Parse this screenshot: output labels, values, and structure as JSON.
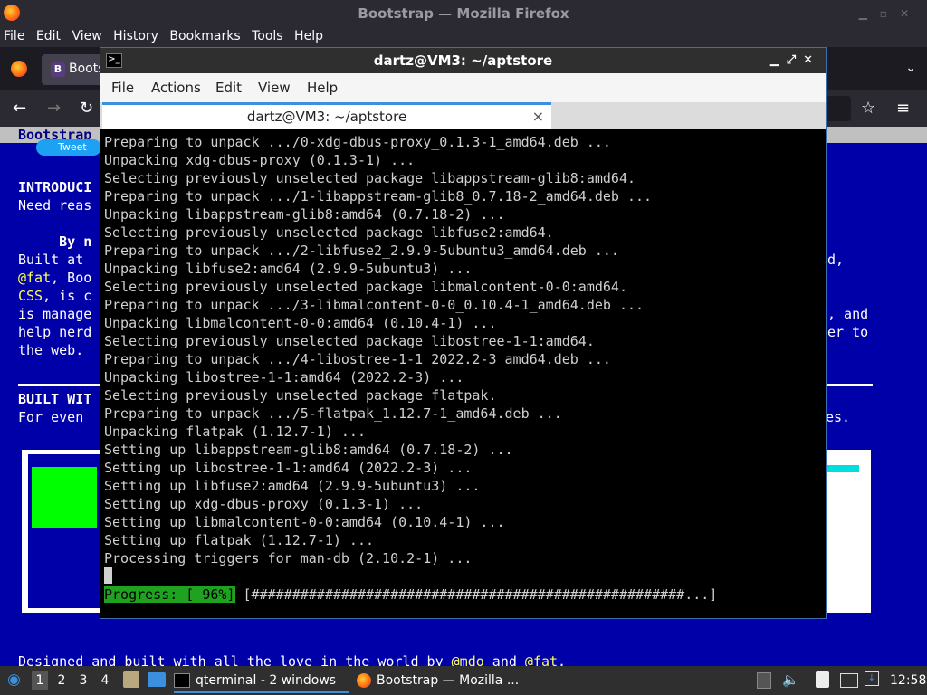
{
  "firefox": {
    "window_title": "Bootstrap — Mozilla Firefox",
    "menu": [
      "File",
      "Edit",
      "View",
      "History",
      "Bookmarks",
      "Tools",
      "Help"
    ],
    "tab_label": "Boots",
    "tab_favicon": "B"
  },
  "page": {
    "brand": "Bootstrap",
    "tweet": "Tweet",
    "intro_heading": "INTRODUCI",
    "intro_text": "Need reas",
    "by_line": "     By n",
    "body_lines": [
      {
        "left": "Built at ",
        "right": "d,"
      },
      {
        "left_hl": "@fat",
        "left": ", Boo",
        "right": ""
      },
      {
        "left_hl": "CSS",
        "left": ", is c",
        "right": ", and"
      },
      {
        "left": "is manage",
        "right": ""
      },
      {
        "left": "help nerd",
        "right": "er to"
      },
      {
        "left": "the web.",
        "right": ""
      }
    ],
    "built_heading": "BUILT WIT",
    "for_even": "For even",
    "for_even_right": "es.",
    "footer_pre": "Designed and built with all the love in the world by ",
    "footer_mdo": "@mdo",
    "footer_and": " and ",
    "footer_fat": "@fat",
    "footer_end": "."
  },
  "terminal": {
    "window_title": "dartz@VM3: ~/aptstore",
    "menu": [
      "File",
      "Actions",
      "Edit",
      "View",
      "Help"
    ],
    "tab_title": "dartz@VM3: ~/aptstore",
    "tab_close": "×",
    "lines": [
      "Preparing to unpack .../0-xdg-dbus-proxy_0.1.3-1_amd64.deb ...",
      "Unpacking xdg-dbus-proxy (0.1.3-1) ...",
      "Selecting previously unselected package libappstream-glib8:amd64.",
      "Preparing to unpack .../1-libappstream-glib8_0.7.18-2_amd64.deb ...",
      "Unpacking libappstream-glib8:amd64 (0.7.18-2) ...",
      "Selecting previously unselected package libfuse2:amd64.",
      "Preparing to unpack .../2-libfuse2_2.9.9-5ubuntu3_amd64.deb ...",
      "Unpacking libfuse2:amd64 (2.9.9-5ubuntu3) ...",
      "Selecting previously unselected package libmalcontent-0-0:amd64.",
      "Preparing to unpack .../3-libmalcontent-0-0_0.10.4-1_amd64.deb ...",
      "Unpacking libmalcontent-0-0:amd64 (0.10.4-1) ...",
      "Selecting previously unselected package libostree-1-1:amd64.",
      "Preparing to unpack .../4-libostree-1-1_2022.2-3_amd64.deb ...",
      "Unpacking libostree-1-1:amd64 (2022.2-3) ...",
      "Selecting previously unselected package flatpak.",
      "Preparing to unpack .../5-flatpak_1.12.7-1_amd64.deb ...",
      "Unpacking flatpak (1.12.7-1) ...",
      "Setting up libappstream-glib8:amd64 (0.7.18-2) ...",
      "Setting up libostree-1-1:amd64 (2022.2-3) ...",
      "Setting up libfuse2:amd64 (2.9.9-5ubuntu3) ...",
      "Setting up xdg-dbus-proxy (0.1.3-1) ...",
      "Setting up libmalcontent-0-0:amd64 (0.10.4-1) ...",
      "Setting up flatpak (1.12.7-1) ...",
      "Processing triggers for man-db (2.10.2-1) ..."
    ],
    "progress_label": "Progress: [ 96%]",
    "progress_bar": " [#####################################################...]",
    "progress_percent": 96
  },
  "taskbar": {
    "desktops": [
      "1",
      "2",
      "3",
      "4"
    ],
    "tasks": [
      {
        "label": "qterminal - 2 windows"
      },
      {
        "label": "Bootstrap — Mozilla ..."
      }
    ],
    "clock": "12:58"
  },
  "colors": {
    "page_background": "#0000a8",
    "highlight": "#ffff55",
    "progress_green": "#1fa21f",
    "terminal_accent": "#3c8fdd"
  }
}
